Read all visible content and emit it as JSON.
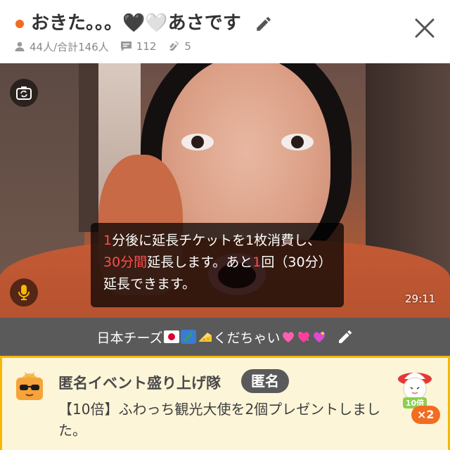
{
  "header": {
    "title": "おきた。。。🖤🤍あさです",
    "viewers": "44人/合計146人",
    "comments": "112",
    "claps": "5"
  },
  "video": {
    "notice_parts": [
      "1",
      "分後に延長チケットを1枚消費し、",
      "30分間",
      "延長します。あと",
      "1",
      "回（30分）延長できます。"
    ],
    "timer": "29:11"
  },
  "caption": {
    "prefix": "日本チーズ",
    "suffix": "くだちゃい"
  },
  "event": {
    "name": "匿名イベント盛り上げ隊",
    "badge": "匿名",
    "message": "【10倍】ふわっち観光大使を2個プレゼントしました。",
    "gift_label": "10倍",
    "multiplier": "×2"
  },
  "colors": {
    "accent": "#f36c21",
    "highlight": "#ff4d4d",
    "event_border": "#f5b800",
    "event_bg": "#fdf5d8"
  }
}
